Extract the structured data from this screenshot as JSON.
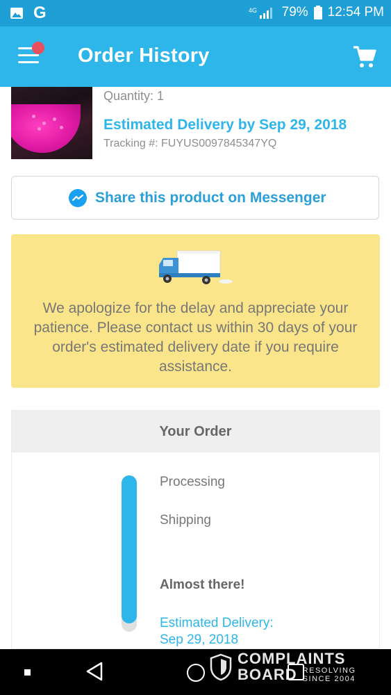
{
  "status_bar": {
    "battery": "79%",
    "time": "12:54 PM",
    "icons": [
      "image-icon",
      "google-icon",
      "signal-icon",
      "battery-icon"
    ]
  },
  "app_bar": {
    "title": "Order History",
    "menu_icon": "menu-icon",
    "cart_icon": "cart-icon",
    "notification_color": "#e9505b"
  },
  "product": {
    "quantity": "Quantity: 1",
    "estimated_delivery": "Estimated Delivery by Sep 29, 2018",
    "tracking": "Tracking #: FUYUS0097845347YQ"
  },
  "share": {
    "label": "Share this product on Messenger",
    "icon": "messenger-icon"
  },
  "notice": {
    "icon": "truck-icon",
    "text": "We apologize for the delay and appreciate your patience. Please contact us within 30 days of your order's estimated delivery date if you require assistance."
  },
  "your_order": {
    "title": "Your Order",
    "progress": 0.95,
    "steps": {
      "processing": "Processing",
      "shipping": "Shipping",
      "almost": "Almost there!",
      "est_label": "Estimated Delivery:",
      "est_date": "Sep 29, 2018"
    }
  },
  "watermark": {
    "line1": "COMPLAINTS",
    "line2": "BOARD",
    "tagline1": "RESOLVING",
    "tagline2": "SINCE 2004"
  },
  "colors": {
    "accent": "#2eb5ea",
    "notice_bg": "#fbe58a",
    "status_bar": "#1e9fd6"
  }
}
